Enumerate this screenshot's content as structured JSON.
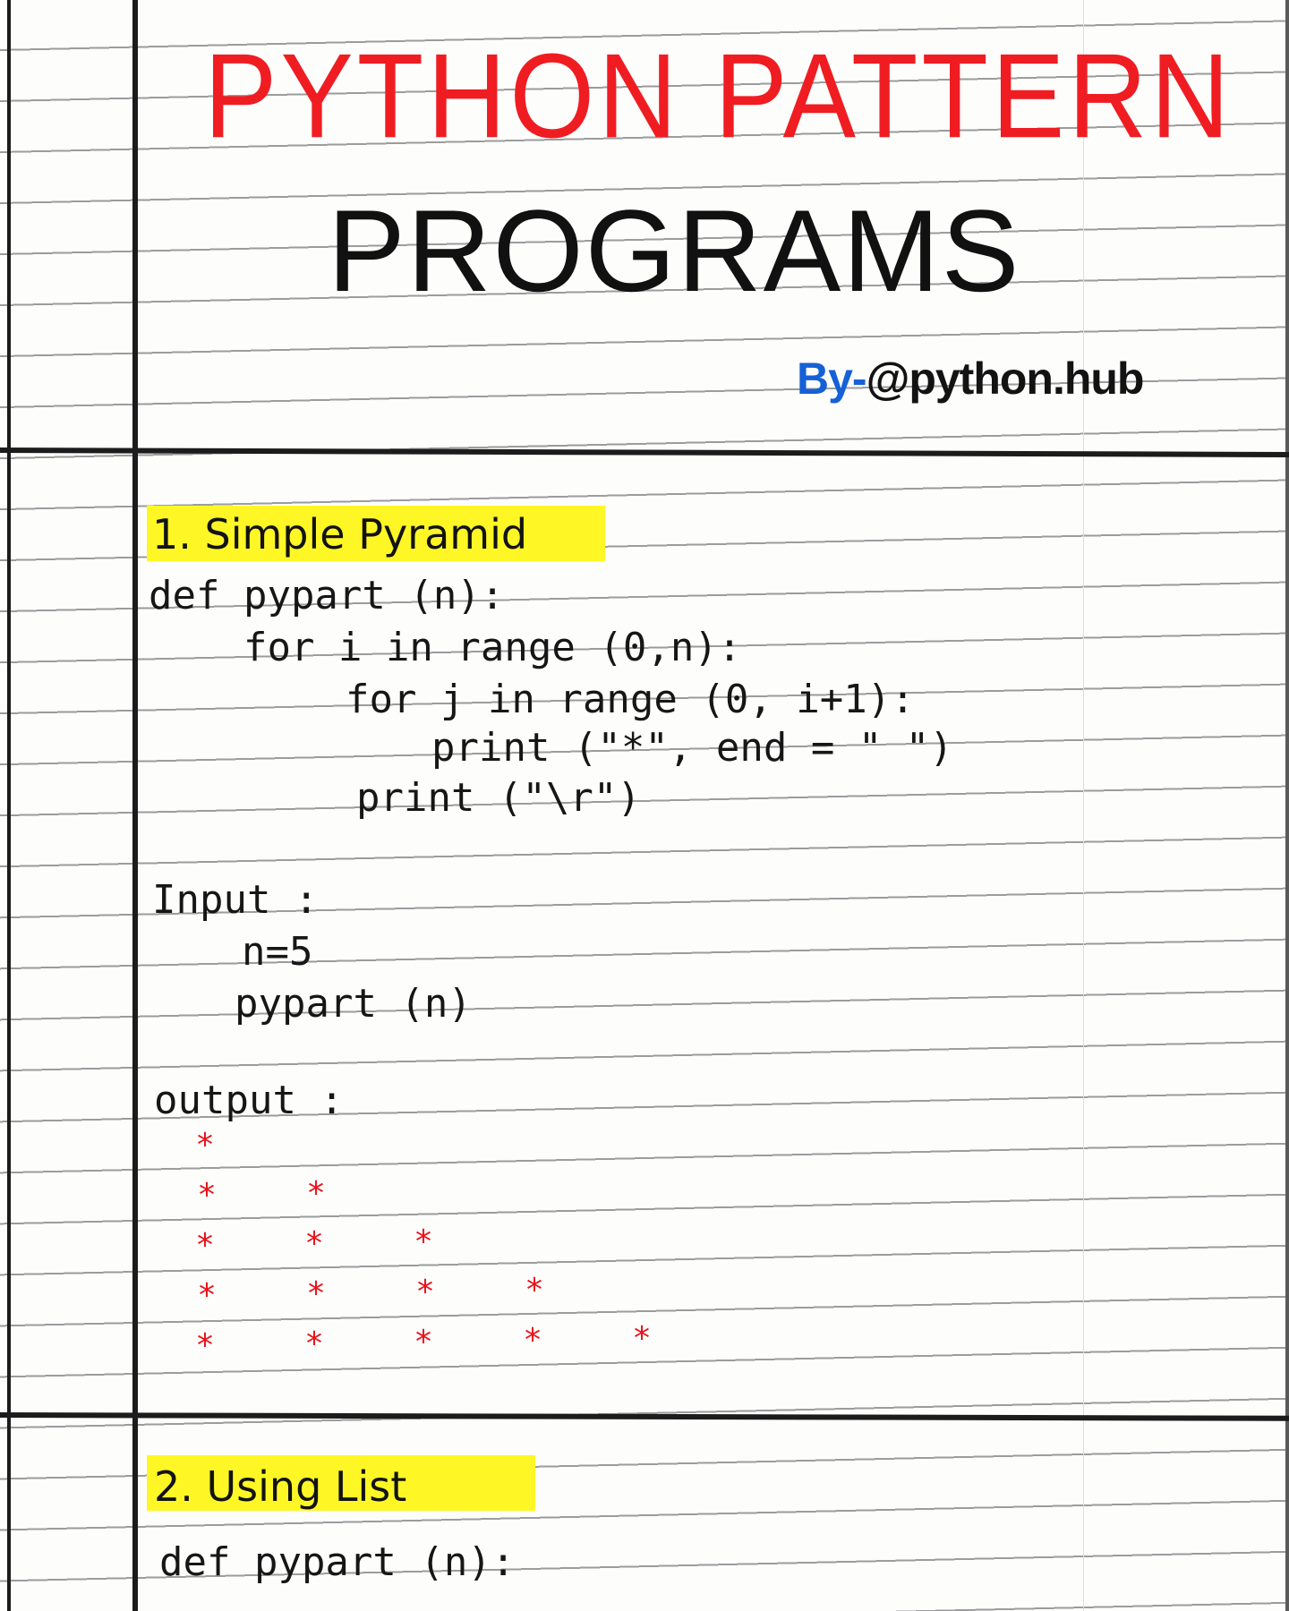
{
  "header": {
    "title_line1": "PYTHON PATTERN",
    "title_line2": "PROGRAMS",
    "by_label": "By-",
    "author": "@python.hub"
  },
  "section1": {
    "heading": "1. Simple Pyramid",
    "code": [
      "def pypart (n):",
      "for i in range (0,n):",
      "for j in range (0, i+1):",
      "print (\"*\", end = \" \")",
      "print (\"\\r\")"
    ],
    "input_label": "Input :",
    "input_lines": [
      "n=5",
      "pypart (n)"
    ],
    "output_label": "output :",
    "output_rows": [
      1,
      2,
      3,
      4,
      5
    ],
    "star_glyph": "*"
  },
  "section2": {
    "heading": "2. Using List",
    "code": [
      "def pypart (n):"
    ]
  },
  "colors": {
    "title_red": "#ef1d22",
    "title_black": "#111111",
    "by_blue": "#1560d6",
    "highlight": "#fff725",
    "star_red": "#e8141c"
  }
}
